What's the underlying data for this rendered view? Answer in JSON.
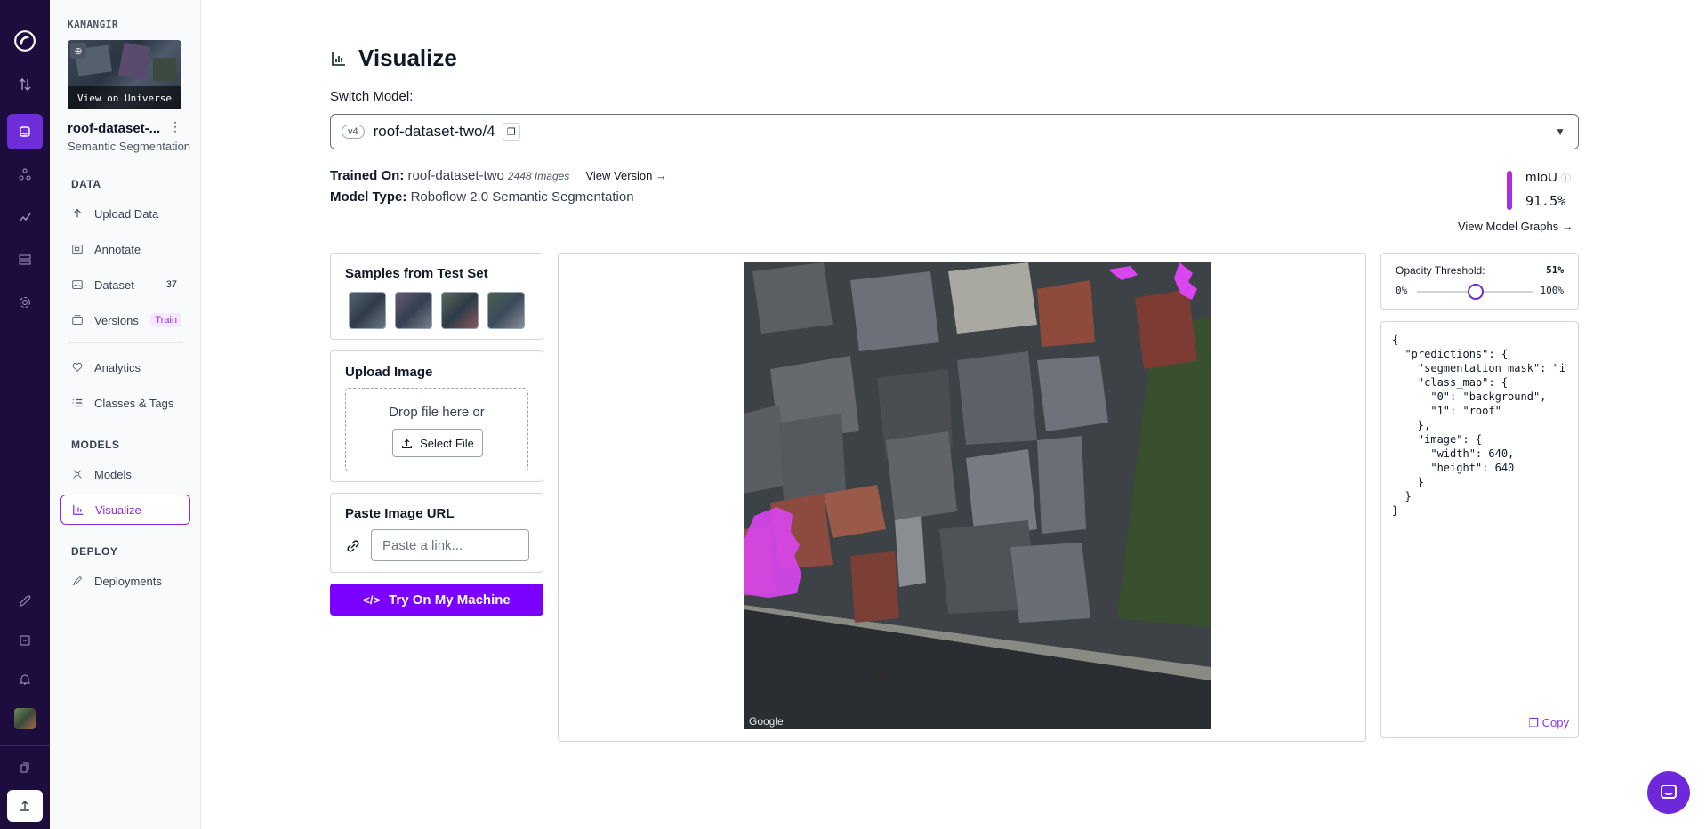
{
  "workspace": "KAMANGIR",
  "project": {
    "name": "roof-dataset-...",
    "type": "Semantic Segmentation",
    "view_on_universe": "View on Universe"
  },
  "sidebar": {
    "sections": {
      "data": "DATA",
      "models": "MODELS",
      "deploy": "DEPLOY"
    },
    "items": {
      "upload": "Upload Data",
      "annotate": "Annotate",
      "dataset": "Dataset",
      "dataset_count": "37",
      "versions": "Versions",
      "versions_badge": "Train",
      "analytics": "Analytics",
      "classes": "Classes & Tags",
      "models": "Models",
      "visualize": "Visualize",
      "deployments": "Deployments"
    }
  },
  "page": {
    "title": "Visualize",
    "switch_model_label": "Switch Model:",
    "model_version": "v4",
    "model_name": "roof-dataset-two/4",
    "trained_on_label": "Trained On:",
    "trained_on_value": "roof-dataset-two",
    "images_count": "2448 Images",
    "view_version": "View Version →",
    "model_type_label": "Model Type:",
    "model_type_value": "Roboflow 2.0 Semantic Segmentation",
    "metric_label": "mIoU",
    "metric_value": "91.5%",
    "view_model_graphs": "View Model Graphs →"
  },
  "samples": {
    "title": "Samples from Test Set"
  },
  "upload": {
    "title": "Upload Image",
    "drop_text": "Drop file here or",
    "select_file": "Select File"
  },
  "paste": {
    "title": "Paste Image URL",
    "placeholder": "Paste a link..."
  },
  "try_button": "Try On My Machine",
  "image": {
    "watermark": "Google"
  },
  "opacity": {
    "label": "Opacity Threshold:",
    "value": "51%",
    "value_fraction": 0.51,
    "min": "0%",
    "max": "100%"
  },
  "json_output": "{\n  \"predictions\": {\n    \"segmentation_mask\": \"iV\n    \"class_map\": {\n      \"0\": \"background\",\n      \"1\": \"roof\"\n    },\n    \"image\": {\n      \"width\": 640,\n      \"height\": 640\n    }\n  }\n}",
  "copy_label": "Copy",
  "colors": {
    "accent": "#7c00ff",
    "rail": "#1d0d3f",
    "mask": "#d946ef"
  }
}
